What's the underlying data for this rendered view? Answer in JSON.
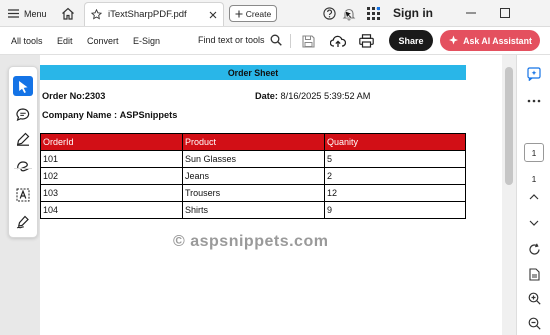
{
  "titlebar": {
    "menu_label": "Menu",
    "tab_title": "iTextSharpPDF.pdf",
    "create_label": "Create",
    "sign_in": "Sign in"
  },
  "toolbar": {
    "items": [
      "All tools",
      "Edit",
      "Convert",
      "E-Sign"
    ],
    "find_label": "Find text or tools",
    "share_label": "Share",
    "ask_ai_label": "Ask AI Assistant"
  },
  "colors": {
    "banner": "#29b6e8",
    "table_header": "#d20f16",
    "ask_ai": "#e4505f",
    "active_tool": "#1473e6"
  },
  "document": {
    "banner_title": "Order Sheet",
    "order_no_label": "Order No:",
    "order_no": "2303",
    "date_label": "Date:",
    "date": "8/16/2025 5:39:52 AM",
    "company_label": "Company Name :",
    "company": "ASPSnippets",
    "columns": [
      "OrderId",
      "Product",
      "Quanity"
    ],
    "rows": [
      [
        "101",
        "Sun Glasses",
        "5"
      ],
      [
        "102",
        "Jeans",
        "2"
      ],
      [
        "103",
        "Trousers",
        "12"
      ],
      [
        "104",
        "Shirts",
        "9"
      ]
    ],
    "watermark": "© aspsnippets.com"
  },
  "right_panel": {
    "current_page": "1",
    "total_pages": "1"
  }
}
